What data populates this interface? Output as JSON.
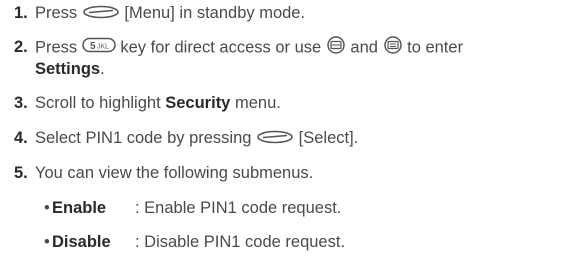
{
  "steps": [
    {
      "number": "1.",
      "before": "Press",
      "icon": "soft-key-icon",
      "after": "[Menu] in standby mode."
    },
    {
      "number": "2.",
      "before": "Press",
      "icon1": "key-5-icon",
      "middle1": "key for direct access or use",
      "icon2": "nav-left-icon",
      "middle2": "and",
      "icon3": "nav-right-icon",
      "after": "to enter",
      "line2_bold": "Settings",
      "line2_end": "."
    },
    {
      "number": "3.",
      "before": "Scroll to highlight",
      "bold": "Security",
      "after": "menu."
    },
    {
      "number": "4.",
      "before": "Select PIN1 code by pressing",
      "icon": "soft-key-icon",
      "after": "[Select]."
    },
    {
      "number": "5.",
      "text": "You can view the following submenus."
    }
  ],
  "submenus": [
    {
      "bullet": "•",
      "term": "Enable",
      "desc": ": Enable PIN1 code request."
    },
    {
      "bullet": "•",
      "term": "Disable",
      "desc": ": Disable PIN1 code request."
    }
  ]
}
